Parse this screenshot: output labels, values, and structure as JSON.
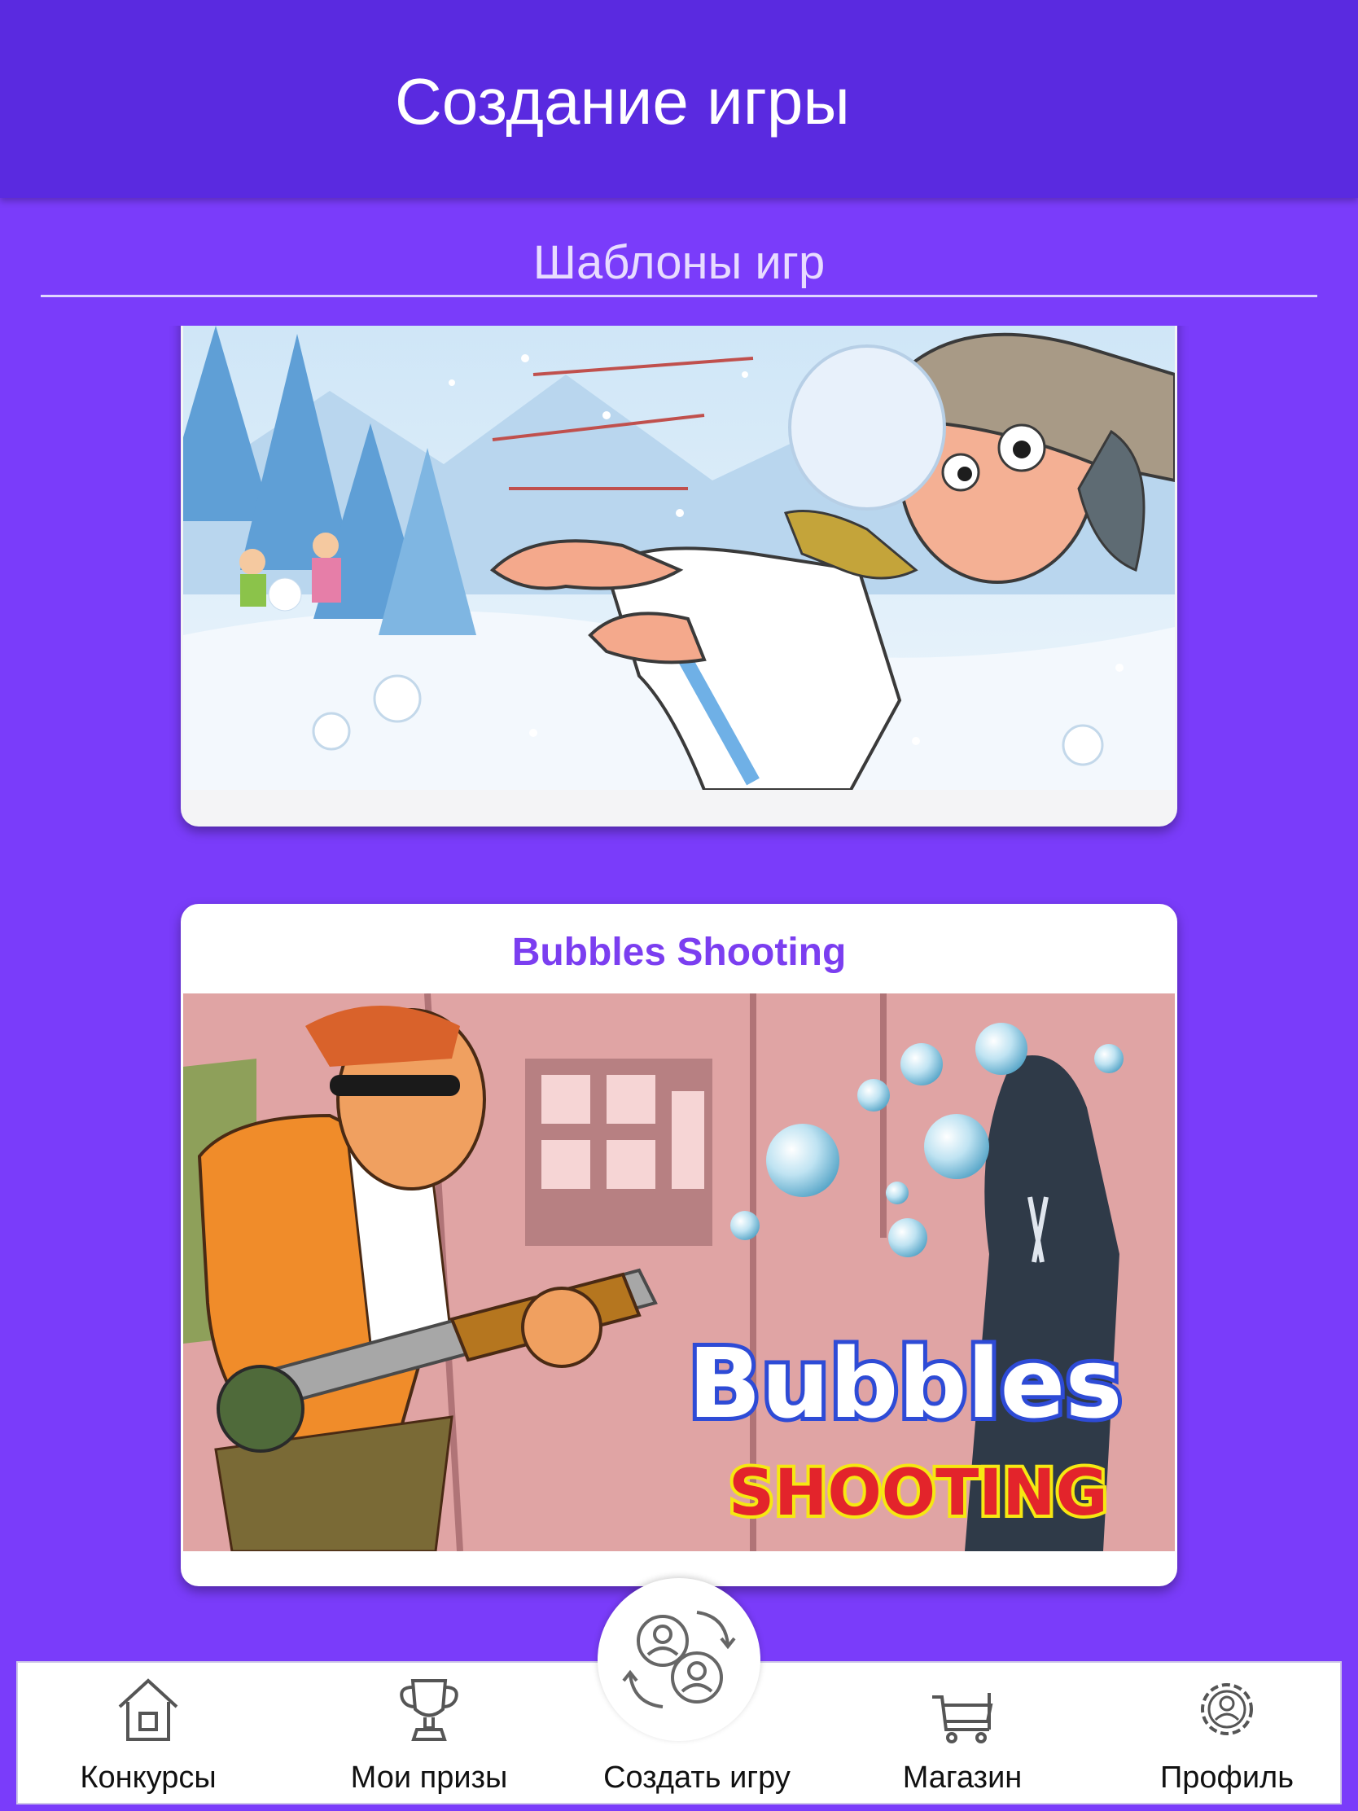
{
  "header": {
    "title": "Создание игры"
  },
  "section": {
    "title": "Шаблоны игр"
  },
  "templates": [
    {
      "title": "",
      "image": "snowball-fight-illustration"
    },
    {
      "title": "Bubbles Shooting",
      "image": "bubbles-shooting-illustration",
      "logo_text": [
        "Bubbles",
        "SHOOTING"
      ]
    }
  ],
  "nav": {
    "items": [
      {
        "label": "Конкурсы",
        "icon": "home-icon"
      },
      {
        "label": "Мои призы",
        "icon": "trophy-icon"
      },
      {
        "label": "Создать игру",
        "icon": "create-game-icon",
        "active": true
      },
      {
        "label": "Магазин",
        "icon": "cart-icon"
      },
      {
        "label": "Профиль",
        "icon": "profile-gear-icon"
      }
    ]
  },
  "colors": {
    "header": "#5a2ae0",
    "background": "#7a3cfa",
    "card_title": "#7b3ef0",
    "nav_bg": "#ffffff"
  }
}
